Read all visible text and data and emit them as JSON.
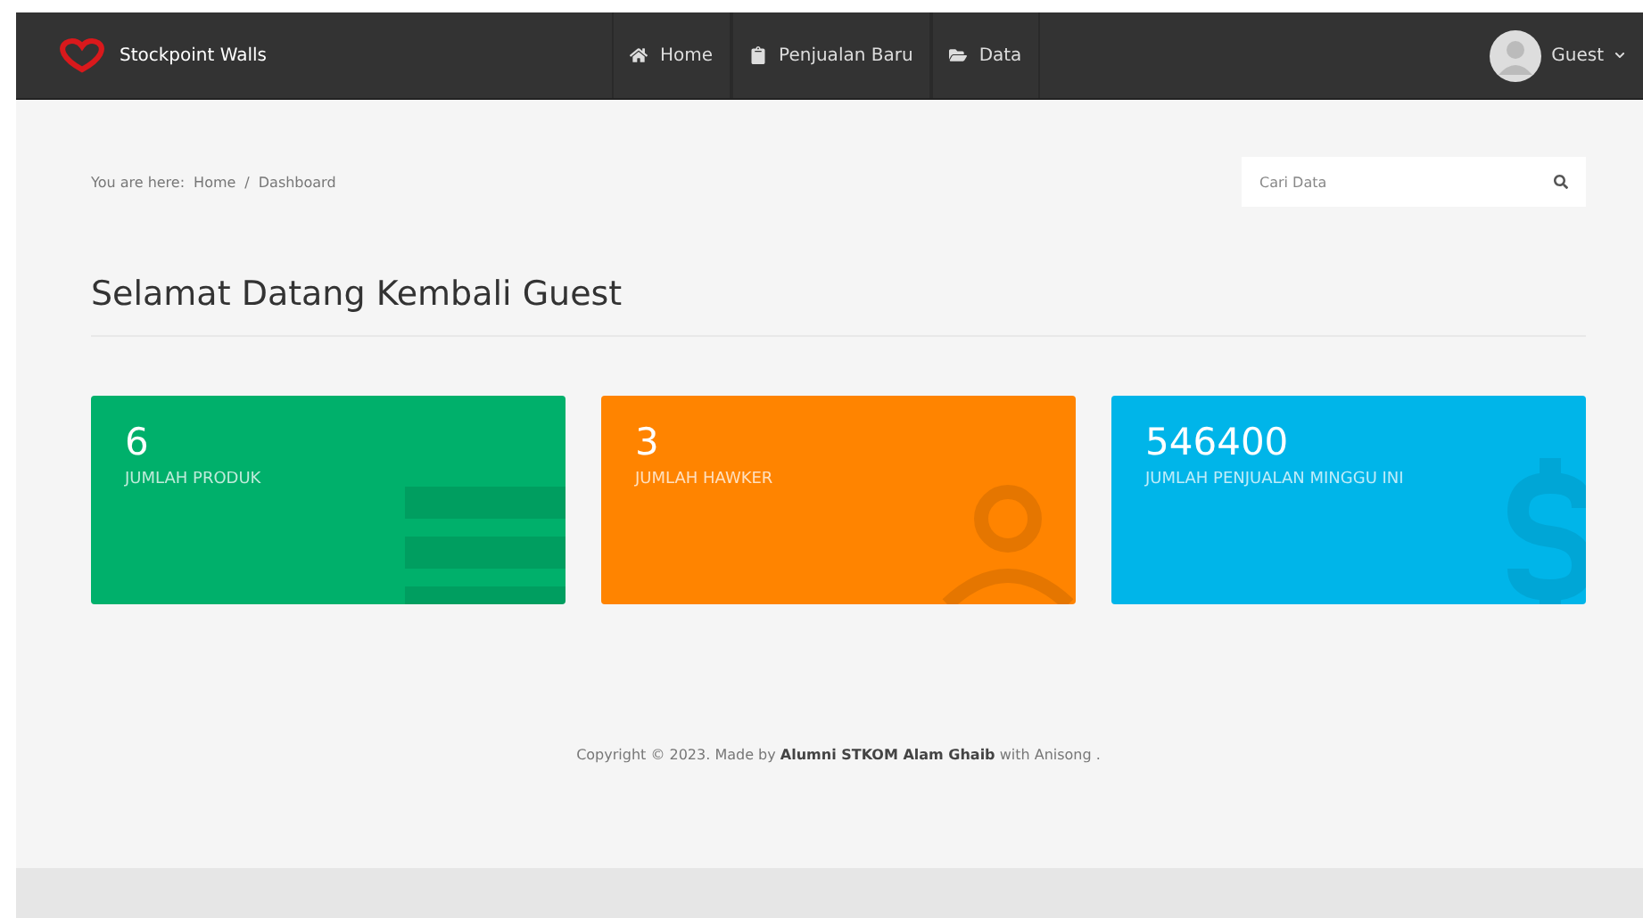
{
  "navbar": {
    "brand": "Stockpoint Walls",
    "menu": [
      {
        "label": "Home",
        "selected": false
      },
      {
        "label": "Penjualan Baru",
        "selected": false
      },
      {
        "label": "Data",
        "selected": false
      }
    ],
    "user": {
      "name": "Guest"
    }
  },
  "breadcrumb": {
    "prefix": "You are here:",
    "items": [
      "Home",
      "Dashboard"
    ],
    "separator": "/"
  },
  "search": {
    "placeholder": "Cari Data"
  },
  "heading": "Selamat Datang Kembali Guest",
  "cards": [
    {
      "value": "6",
      "label": "JUMLAH PRODUK",
      "color": "#00b06b"
    },
    {
      "value": "3",
      "label": "JUMLAH HAWKER",
      "color": "#ff8400"
    },
    {
      "value": "546400",
      "label": "JUMLAH PENJUALAN MINGGU INI",
      "color": "#00b5e9"
    }
  ],
  "footer": "Copyright © 2023. Made by **Alumni STKOM Alam Ghaib** with Anisong ."
}
